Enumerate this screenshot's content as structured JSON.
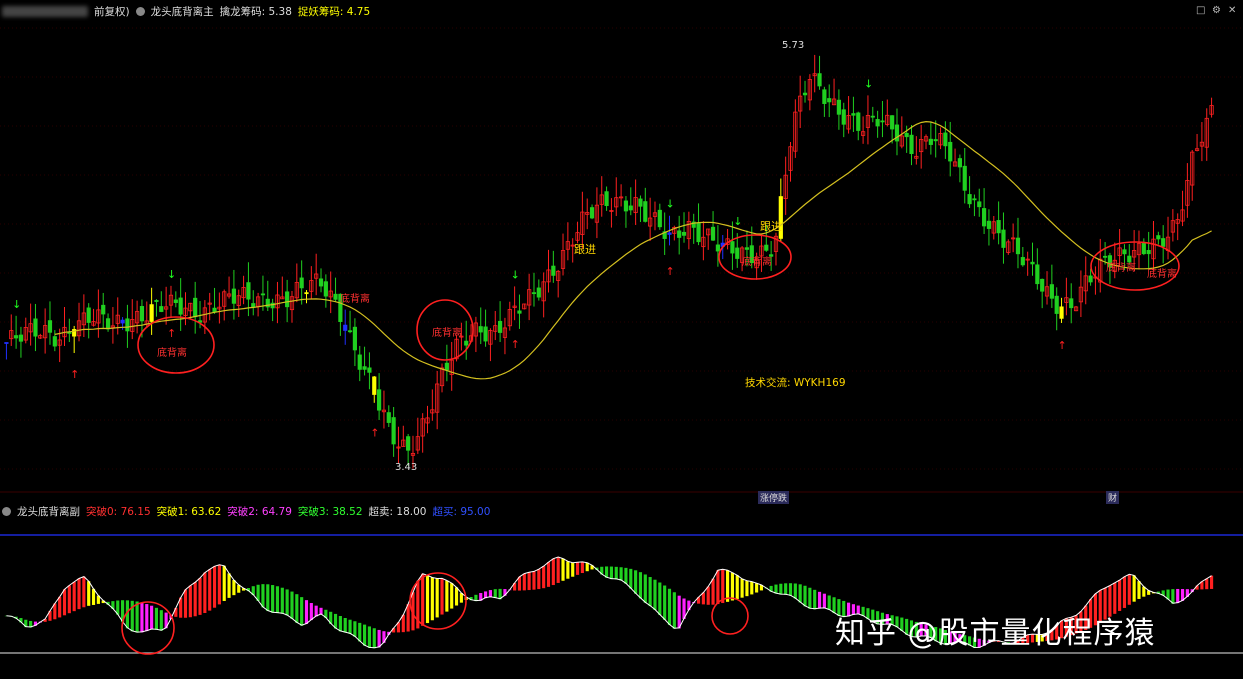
{
  "top_bar": {
    "adjust_label": "前复权)",
    "indicator_name": "龙头底背离主",
    "dragon_label": "擒龙筹码:",
    "dragon_value": "5.38",
    "demon_label": "捉妖筹码:",
    "demon_value": "4.75"
  },
  "bottom_bar": {
    "indicator_name": "龙头底背离副",
    "b0_label": "突破0:",
    "b0_value": "76.15",
    "b1_label": "突破1:",
    "b1_value": "63.62",
    "b2_label": "突破2:",
    "b2_value": "64.79",
    "b3_label": "突破3:",
    "b3_value": "38.52",
    "ob_label": "超卖:",
    "ob_value": "18.00",
    "os_label": "超买:",
    "os_value": "95.00"
  },
  "annotations": {
    "high_label": "5.73",
    "low_label": "3.43",
    "follow_1": "跟进",
    "follow_2": "跟进",
    "divergence": "底背离",
    "contact": "技术交流: WYKH169",
    "tag_1": "涨停跌",
    "tag_2": "财",
    "watermark": "知乎 @股市量化程序猿"
  },
  "chart_data": [
    {
      "type": "candlestick",
      "title": "龙头底背离主",
      "ylim": [
        3.3,
        5.9
      ],
      "series": [
        {
          "name": "擒龙筹码",
          "value": 5.38
        },
        {
          "name": "捉妖筹码",
          "value": 4.75
        }
      ],
      "close": [
        4.05,
        4.08,
        4.12,
        4.1,
        4.15,
        4.18,
        4.16,
        4.2,
        4.22,
        4.25,
        4.26,
        4.24,
        4.28,
        4.3,
        4.3,
        4.32,
        4.31,
        4.35,
        4.4,
        4.28,
        4.0,
        3.75,
        3.5,
        3.43,
        3.6,
        3.85,
        4.05,
        4.15,
        4.12,
        4.2,
        4.3,
        4.45,
        4.6,
        4.75,
        4.85,
        4.9,
        4.88,
        4.75,
        4.65,
        4.75,
        4.7,
        4.6,
        4.55,
        4.58,
        4.65,
        5.3,
        5.6,
        5.5,
        5.4,
        5.3,
        5.35,
        5.3,
        5.2,
        5.25,
        5.15,
        4.95,
        4.8,
        4.65,
        4.55,
        4.45,
        4.3,
        4.25,
        4.4,
        4.55,
        4.6,
        4.58,
        4.6,
        4.75,
        5.2,
        5.4
      ],
      "high_marker": 5.73,
      "low_marker": 3.43
    },
    {
      "type": "bar",
      "title": "龙头底背离副",
      "series": [
        {
          "name": "突破0",
          "value": 76.15
        },
        {
          "name": "突破1",
          "value": 63.62
        },
        {
          "name": "突破2",
          "value": 64.79
        },
        {
          "name": "突破3",
          "value": 38.52
        },
        {
          "name": "超卖",
          "value": 18.0
        },
        {
          "name": "超买",
          "value": 95.0
        }
      ],
      "osc": [
        30,
        22,
        26,
        55,
        60,
        42,
        22,
        16,
        20,
        48,
        66,
        70,
        52,
        38,
        30,
        24,
        30,
        18,
        8,
        4,
        30,
        62,
        62,
        48,
        42,
        45,
        60,
        70,
        76,
        74,
        66,
        58,
        48,
        30,
        20,
        44,
        66,
        64,
        54,
        50,
        42,
        36,
        32,
        30,
        26,
        20,
        14,
        10,
        8,
        6,
        8,
        10,
        14,
        20,
        30,
        44,
        58,
        62,
        50,
        40,
        48,
        64
      ]
    }
  ],
  "colors": {
    "up": "#ff2020",
    "down": "#20d020",
    "ma": "#d4c020",
    "yellow": "#ffff00",
    "magenta": "#ff20ff",
    "blue": "#2030ff",
    "circle": "#ff2020"
  }
}
